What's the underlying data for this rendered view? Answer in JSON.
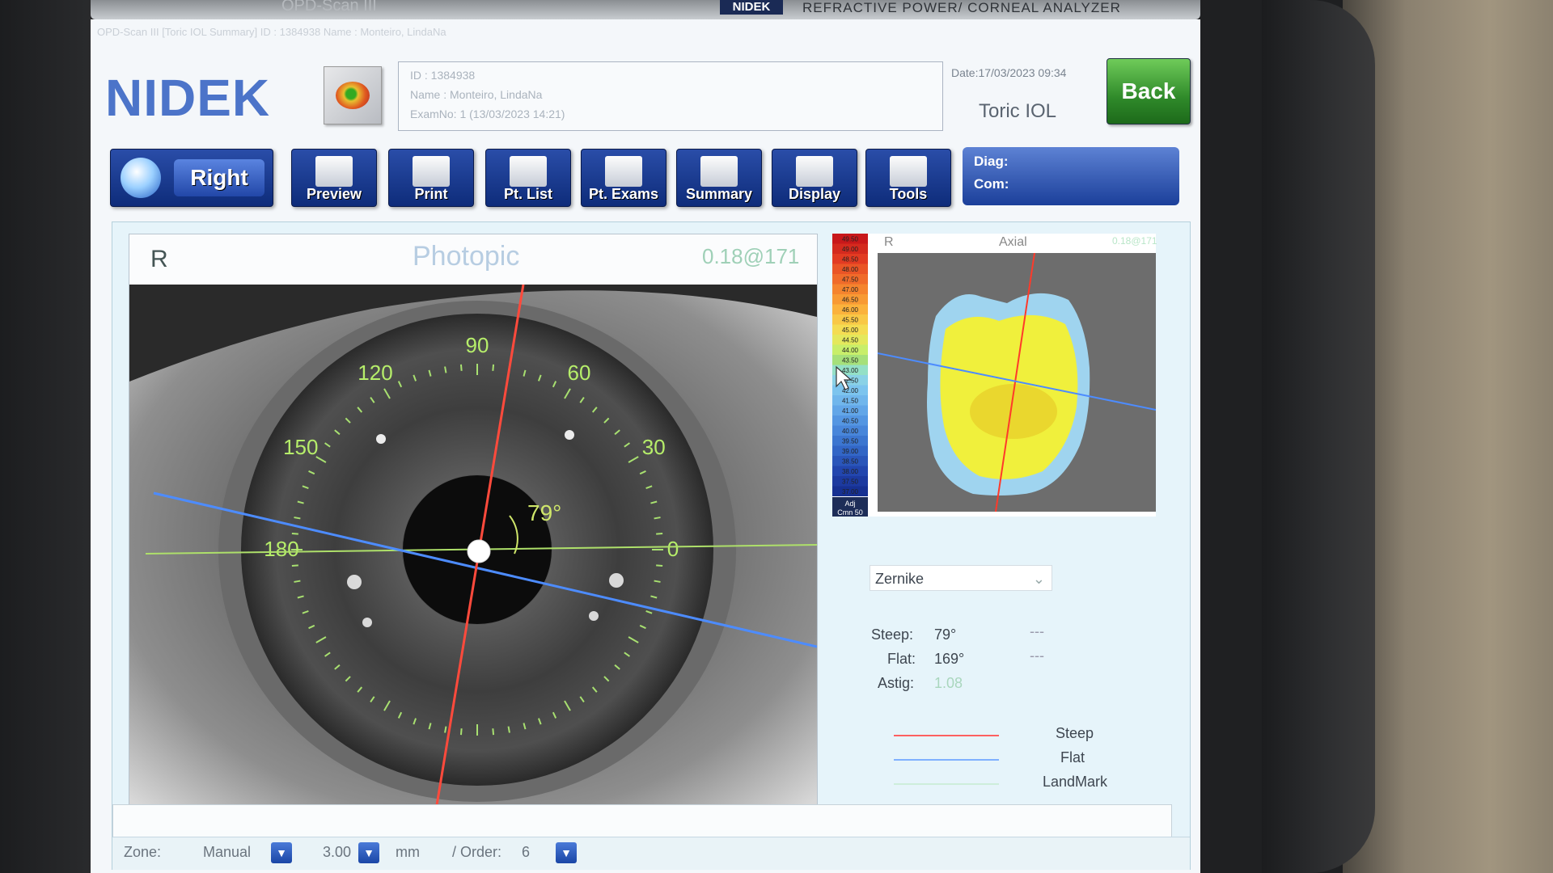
{
  "device": {
    "top_label": "OPD-Scan III",
    "top_brand_badge": "NIDEK",
    "top_product": "REFRACTIVE POWER/ CORNEAL ANALYZER"
  },
  "window": {
    "title": "OPD-Scan III [Toric IOL Summary] ID : 1384938 Name : Monteiro, LindaNa"
  },
  "header": {
    "logo": "NIDEK",
    "patient": {
      "id": "ID : 1384938",
      "name": "Name : Monteiro, LindaNa",
      "exam": "ExamNo: 1 (13/03/2023 14:21)"
    },
    "date": "Date:17/03/2023 09:34",
    "mode": "Toric IOL",
    "back_label": "Back"
  },
  "toolbar": {
    "eye_label": "Right",
    "preview_label": "Preview",
    "print_label": "Print",
    "pt_list_label": "Pt. List",
    "pt_exams_label": "Pt. Exams",
    "summary_label": "Summary",
    "display_label": "Display",
    "tools_label": "Tools",
    "diag_label": "Diag:",
    "com_label": "Com:"
  },
  "image_panel": {
    "eye": "R",
    "title": "Photopic",
    "value": "0.18@171",
    "axis_angle_label": "79°",
    "angle_labels": [
      "90",
      "120",
      "60",
      "150",
      "30",
      "180",
      "0"
    ]
  },
  "topo_panel": {
    "eye": "R",
    "title": "Axial",
    "value": "0.18@171",
    "scale_footer_1": "Adj",
    "scale_footer_2": "Cmn 50",
    "scale_values": [
      "49.50",
      "49.00",
      "48.50",
      "48.00",
      "47.50",
      "47.00",
      "46.50",
      "46.00",
      "45.50",
      "45.00",
      "44.50",
      "44.00",
      "43.50",
      "43.00",
      "42.50",
      "42.00",
      "41.50",
      "41.00",
      "40.50",
      "40.00",
      "39.50",
      "39.00",
      "38.50",
      "38.00",
      "37.50",
      "37.00"
    ]
  },
  "analysis": {
    "method": "Zernike",
    "steep_label": "Steep:",
    "steep_value": "79°",
    "steep_extra": "---",
    "flat_label": "Flat:",
    "flat_value": "169°",
    "flat_extra": "---",
    "astig_label": "Astig:",
    "astig_value": "1.08"
  },
  "legend": {
    "steep": "Steep",
    "flat": "Flat",
    "landmark": "LandMark"
  },
  "colors": {
    "steep_line": "#ff5a5a",
    "flat_line": "#79a9ff",
    "landmark_line": "#c9f0d6",
    "accent_blue": "#1b3f9a",
    "back_green": "#2f8a2a"
  },
  "bottom_bar": {
    "zone_label": "Zone:",
    "zone_value": "Manual",
    "diameter_value": "3.00",
    "unit": "mm",
    "order_label": "/ Order:",
    "order_value": "6"
  }
}
